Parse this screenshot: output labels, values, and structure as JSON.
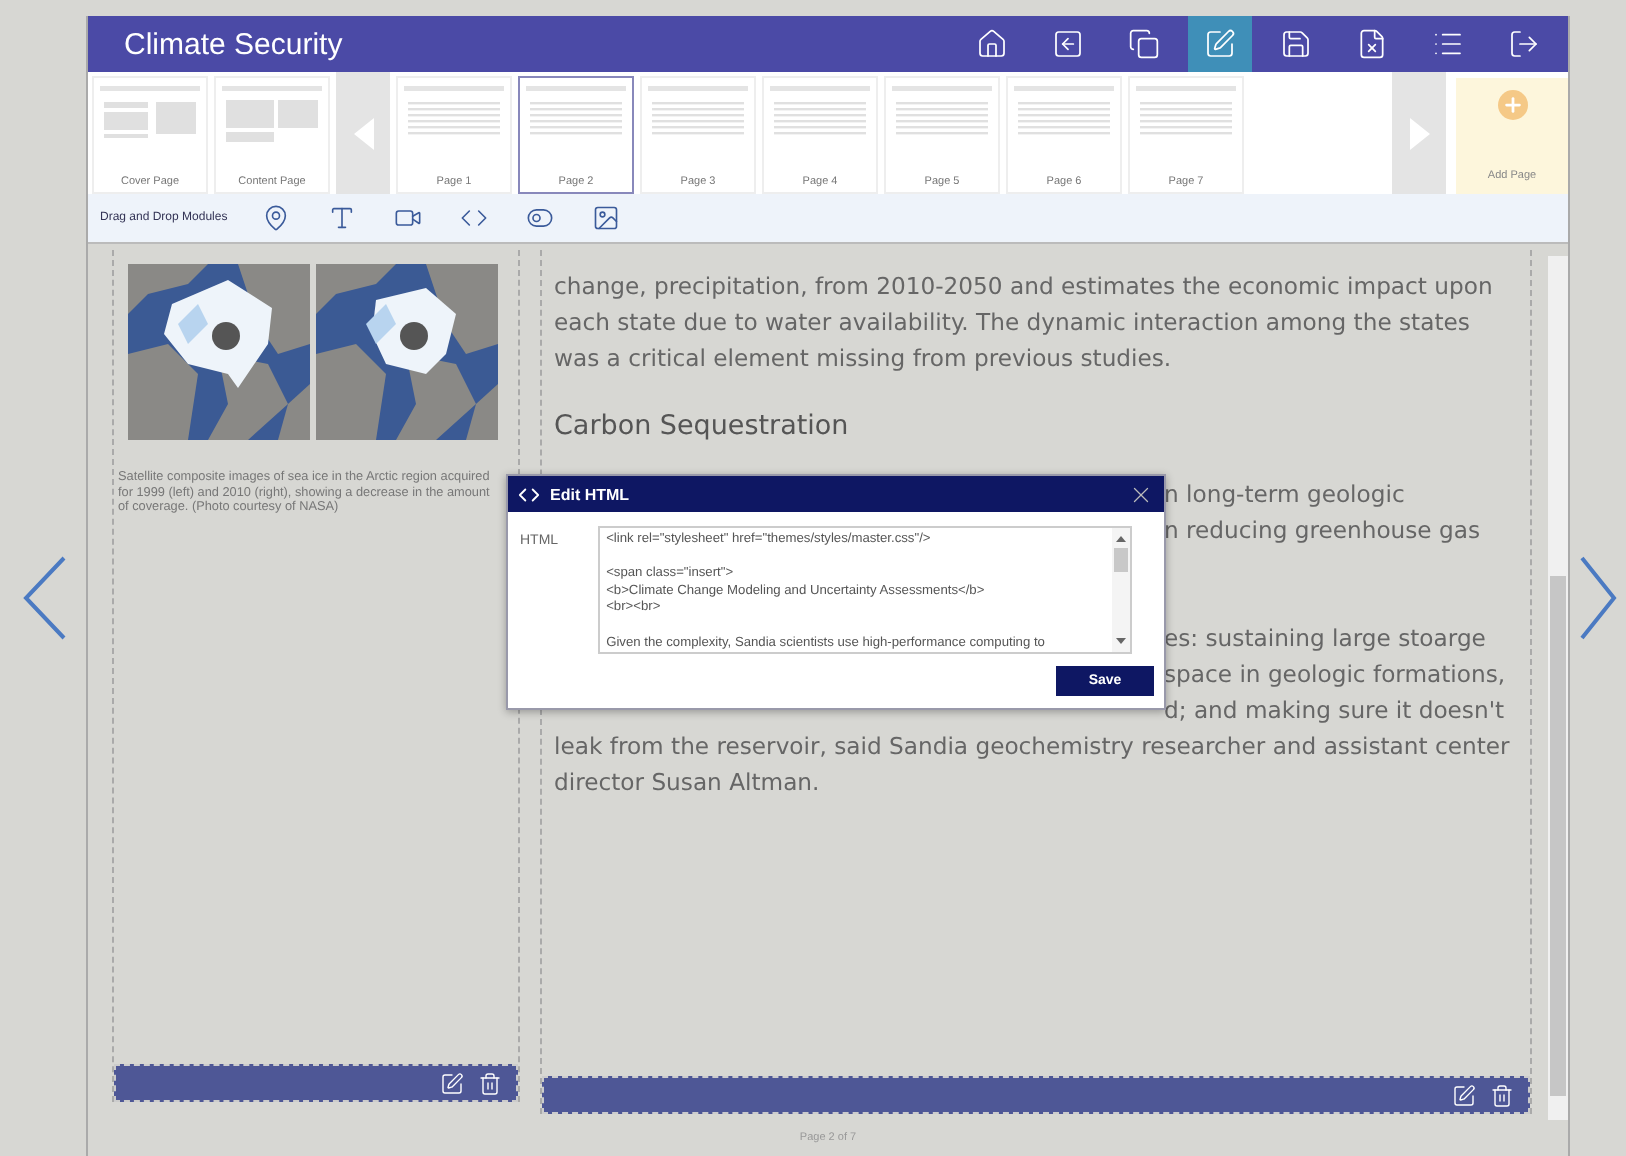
{
  "header": {
    "title": "Climate Security",
    "toolbar": [
      {
        "kind": "home",
        "selected": false
      },
      {
        "kind": "back",
        "selected": false
      },
      {
        "kind": "copy",
        "selected": false
      },
      {
        "kind": "edit",
        "selected": true
      },
      {
        "kind": "save",
        "selected": false
      },
      {
        "kind": "file",
        "selected": false
      },
      {
        "kind": "list",
        "selected": false
      },
      {
        "kind": "exit",
        "selected": false
      }
    ]
  },
  "templates": [
    {
      "label": "Cover Page",
      "kind": "cover"
    },
    {
      "label": "Content Page",
      "kind": "content"
    }
  ],
  "pages": [
    {
      "label": "Page 1",
      "selected": false
    },
    {
      "label": "Page 2",
      "selected": true
    },
    {
      "label": "Page 3",
      "selected": false
    },
    {
      "label": "Page 4",
      "selected": false
    },
    {
      "label": "Page 5",
      "selected": false
    },
    {
      "label": "Page 6",
      "selected": false
    },
    {
      "label": "Page 7",
      "selected": false
    }
  ],
  "add_page": {
    "label": "Add Page"
  },
  "modules_label": "Drag and Drop Modules",
  "left_column": {
    "caption": "Satellite composite images of sea ice in the Arctic region acquired for 1999 (left) and 2010 (right), showing a decrease in the amount of coverage. (Photo courtesy of NASA)"
  },
  "right_column": {
    "blocks": [
      {
        "kind": "paragraph",
        "lines": [
          {
            "kind": "full",
            "text": "change, precipitation, from 2010-2050 and estimates the economic impact upon"
          },
          {
            "kind": "full",
            "text": "each state due to water availability. The dynamic interaction among the states"
          },
          {
            "kind": "full",
            "text": "was a critical element missing from previous studies."
          }
        ]
      },
      {
        "kind": "heading",
        "text": "Carbon Sequestration"
      },
      {
        "kind": "paragraph",
        "lines": [
          {
            "kind": "tail",
            "text": "n long-term geologic"
          },
          {
            "kind": "tail",
            "text": "n reducing greenhouse gas"
          }
        ]
      },
      {
        "kind": "paragraph",
        "lines": [
          {
            "kind": "tail",
            "text": "es: sustaining large stoarge"
          },
          {
            "kind": "tail",
            "text": "space in geologic formations,"
          },
          {
            "kind": "tail",
            "text": "d; and making sure it doesn't"
          },
          {
            "kind": "full",
            "text": "leak from the reservoir, said Sandia geochemistry researcher and assistant center"
          },
          {
            "kind": "full",
            "text": "director Susan Altman."
          }
        ]
      }
    ]
  },
  "page_indicator": "Page 2 of 7",
  "dialog": {
    "title": "Edit HTML",
    "field_label": "HTML",
    "value": "<link rel=\"stylesheet\" href=\"themes/styles/master.css\"/>\n\n<span class=\"insert\">\n<b>Climate Change Modeling and Uncertainty Assessments</b>\n<br><br>\n\nGiven the complexity, Sandia scientists use high-performance computing to",
    "button": "Save"
  }
}
